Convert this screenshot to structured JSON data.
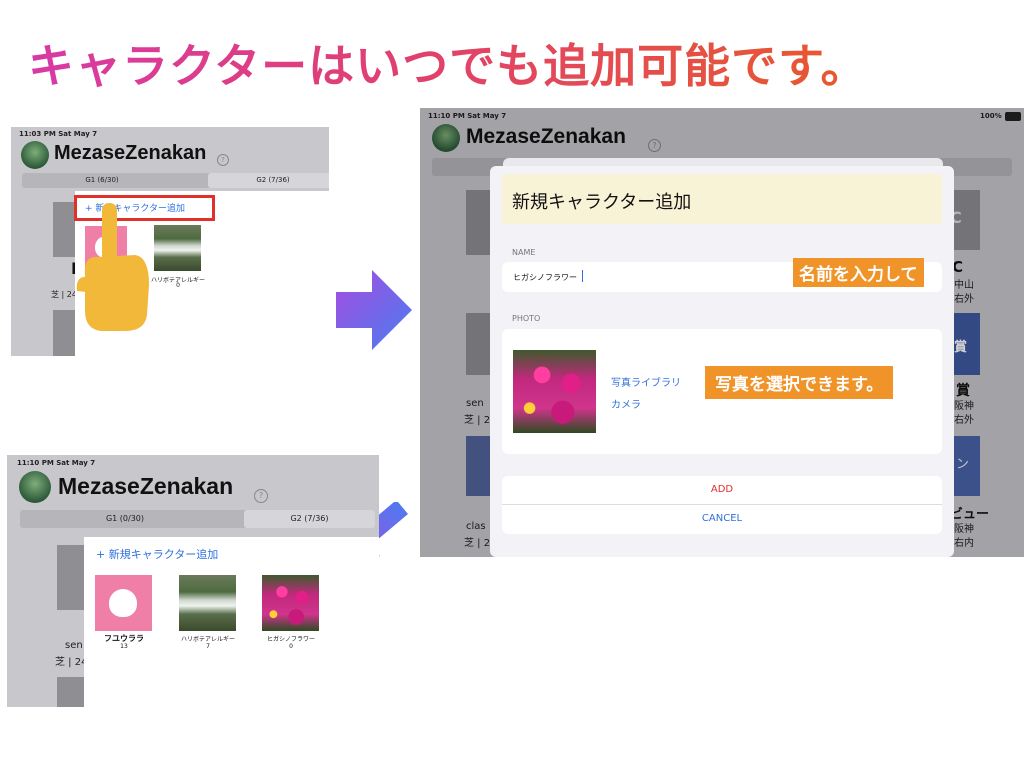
{
  "headline": "キャラクターはいつでも追加可能です。",
  "screen1": {
    "status": "11:03 PM  Sat May 7",
    "app_title": "MezaseZenakan",
    "help_icon": "?",
    "tab_g1": "G1 (6/30)",
    "tab_g2": "G2 (7/36)",
    "add_link": "+ 新規キャラクター追加",
    "char2_name": "ハリボテアレルギー",
    "char2_count": "0",
    "bg_text_big": "I",
    "bg_text_small": "sen",
    "bg_text_meta": "芝 | 24"
  },
  "screen2": {
    "status_left": "11:10 PM  Sat May 7",
    "status_right": "100%",
    "app_title": "MezaseZenakan",
    "help_icon": "?",
    "modal_title": "新規キャラクター追加",
    "name_label": "NAME",
    "name_value": "ヒガシノフラワー",
    "photo_label": "PHOTO",
    "photo_library": "写真ライブラリ",
    "camera": "カメラ",
    "add_button": "ADD",
    "cancel_button": "CANCEL",
    "callout_name": "名前を入力して",
    "callout_photo": "写真を選択できます。",
    "bg_right": [
      "C",
      "C",
      "中山",
      "右外",
      "賞",
      "賞",
      "阪神",
      "右外",
      "ン",
      "ビュー",
      "阪神",
      "右内"
    ],
    "bg_left": [
      "sen",
      "芝 | 22",
      "clas",
      "芝 | 20"
    ]
  },
  "screen3": {
    "status": "11:10 PM  Sat May 7",
    "app_title": "MezaseZenakan",
    "help_icon": "?",
    "tab_g1": "G1 (0/30)",
    "tab_g2": "G2 (7/36)",
    "add_link": "+ 新規キャラクター追加",
    "chars": [
      {
        "name": "フユウララ",
        "count": "13",
        "image": "cat-icon"
      },
      {
        "name": "ハリボテアレルギー",
        "count": "7",
        "image": "waterfall-photo"
      },
      {
        "name": "ヒガシノフラワー",
        "count": "0",
        "image": "flower-photo"
      }
    ],
    "bg_text_small": "sen",
    "bg_text_meta": "芝 | 24"
  },
  "colors": {
    "callout": "#f0942a",
    "link": "#2f6fde",
    "highlight_box": "#e0302a",
    "cancel_add": "#e0302a"
  }
}
